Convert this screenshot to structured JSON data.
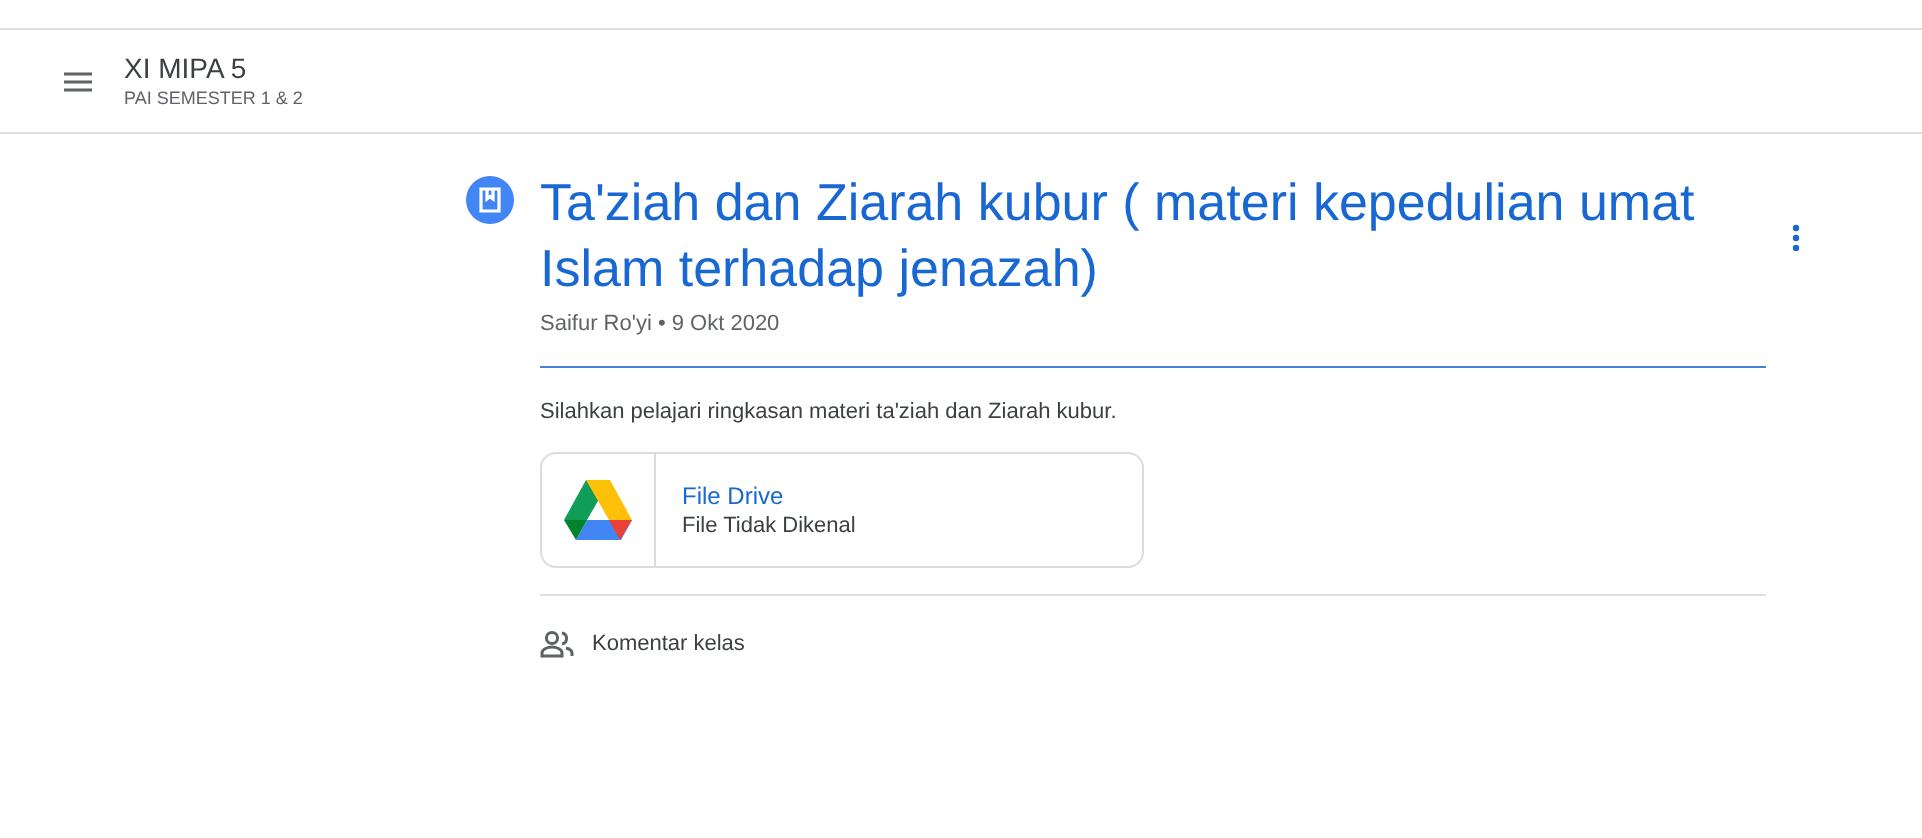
{
  "header": {
    "class_name": "XI MIPA 5",
    "subtitle": "PAI SEMESTER 1 & 2"
  },
  "post": {
    "title": "Ta'ziah dan Ziarah kubur ( materi kepedulian umat Islam terhadap jenazah)",
    "author": "Saifur Ro'yi",
    "separator": "•",
    "date": "9 Okt 2020",
    "description": "Silahkan pelajari ringkasan materi ta'ziah dan Ziarah kubur.",
    "attachments": [
      {
        "title": "File Drive",
        "subtitle": "File Tidak Dikenal"
      }
    ]
  },
  "comments": {
    "label": "Komentar kelas"
  }
}
